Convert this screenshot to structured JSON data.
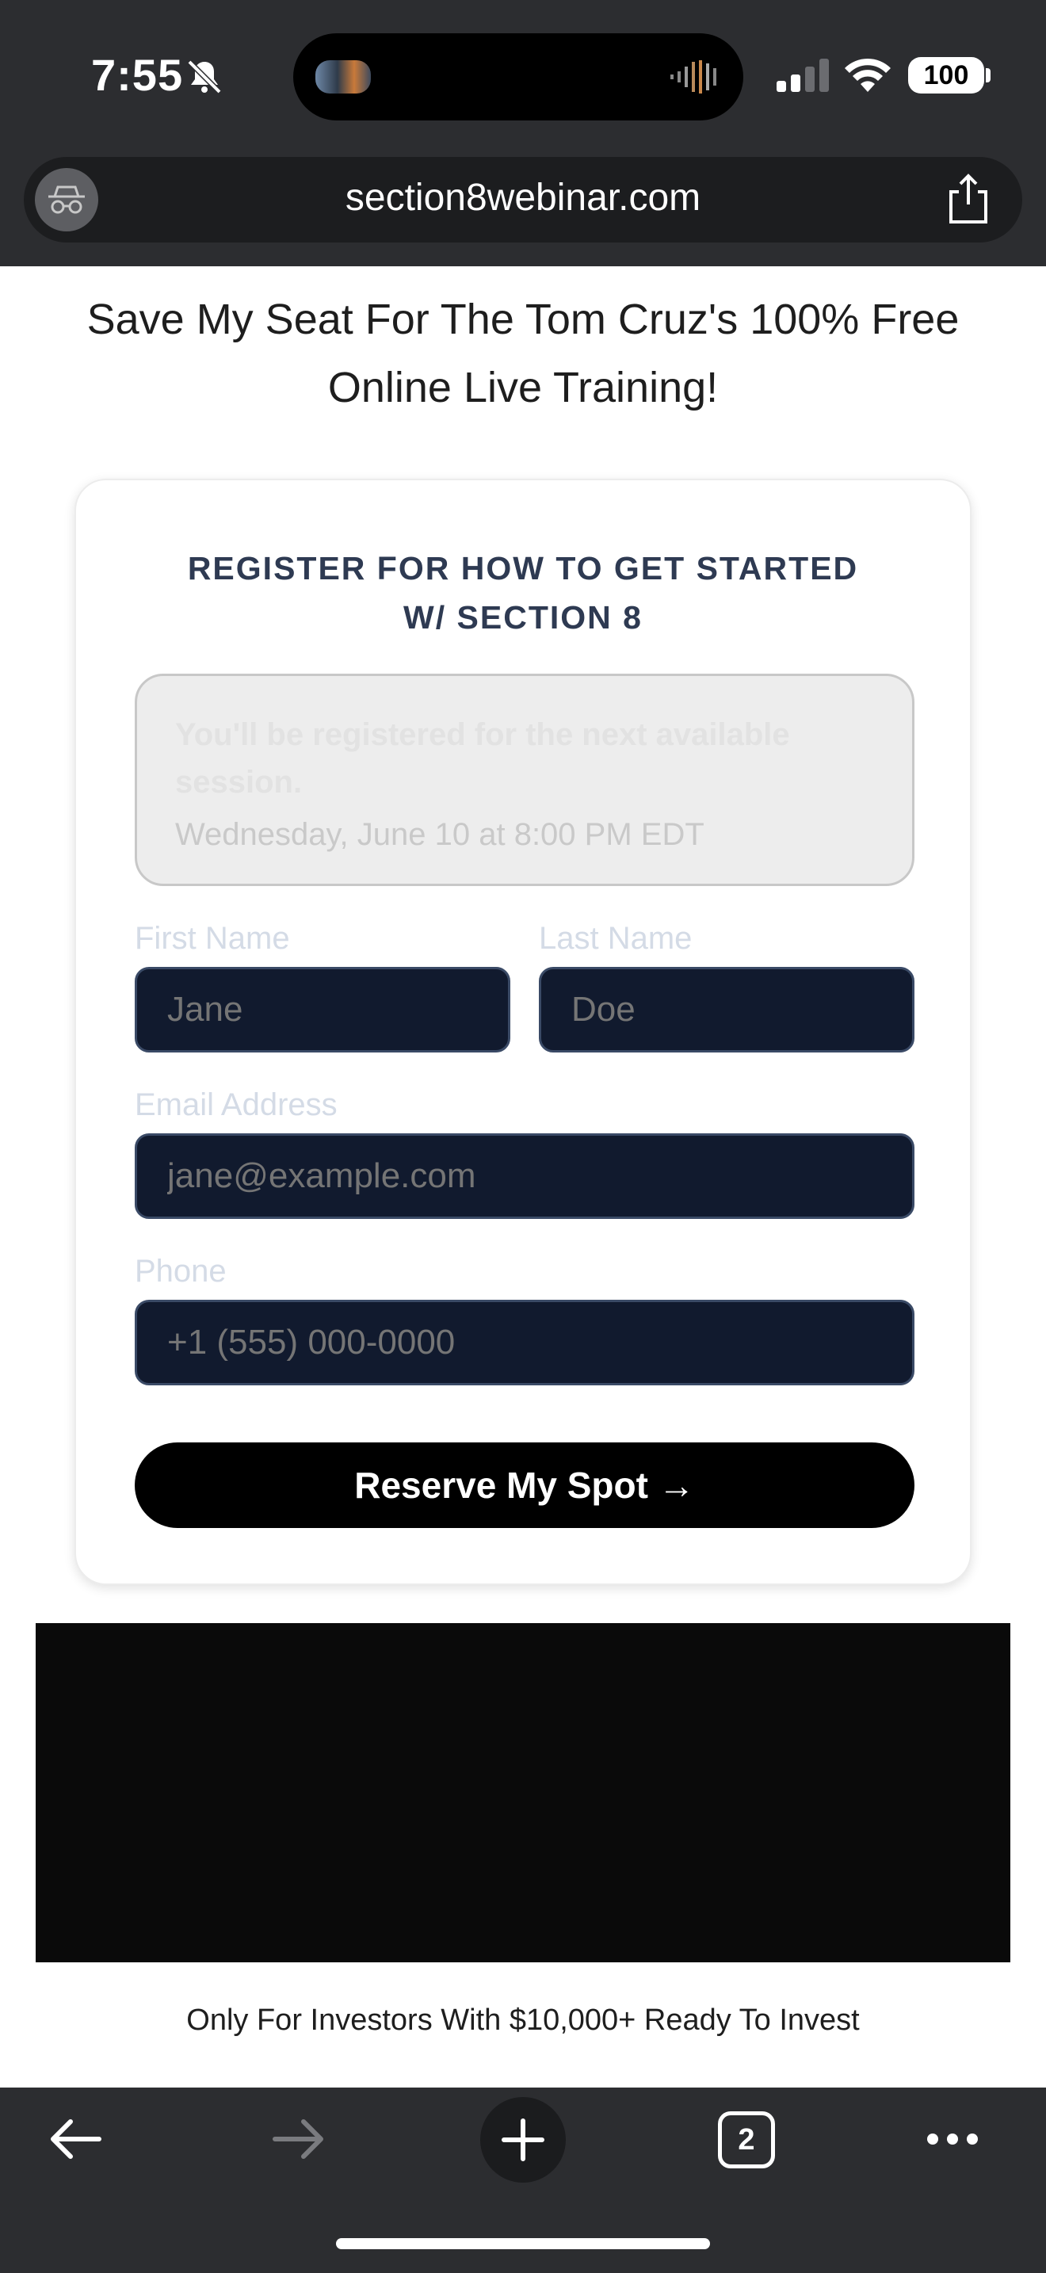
{
  "status_bar": {
    "time": "7:55",
    "battery": "100"
  },
  "browser": {
    "url": "section8webinar.com",
    "tab_count": "2"
  },
  "page": {
    "headline": "Save My Seat For The Tom Cruz's 100% Free Online Live Training!",
    "form": {
      "title": "REGISTER FOR HOW TO GET STARTED W/ SECTION 8",
      "session_note": "You'll be registered for the next available session.",
      "session_date": "Wednesday, June 10 at 8:00 PM EDT",
      "first_name": {
        "label": "First Name",
        "placeholder": "Jane"
      },
      "last_name": {
        "label": "Last Name",
        "placeholder": "Doe"
      },
      "email": {
        "label": "Email Address",
        "placeholder": "jane@example.com"
      },
      "phone": {
        "label": "Phone",
        "placeholder": "+1 (555) 000-0000"
      },
      "submit_label": "Reserve My Spot →"
    },
    "footer_text": "Only For Investors With $10,000+ Ready To Invest"
  },
  "icons": {
    "silent": "bell-slash-icon",
    "incognito": "incognito-icon",
    "share": "share-icon",
    "back": "back-arrow-icon",
    "forward": "forward-arrow-icon",
    "new_tab": "plus-icon",
    "tabs": "tabs-icon",
    "menu": "more-icon"
  },
  "colors": {
    "chrome": "#2c2d30",
    "field_bg": "#111a2e",
    "button": "#000000",
    "title": "#2e3a52"
  }
}
